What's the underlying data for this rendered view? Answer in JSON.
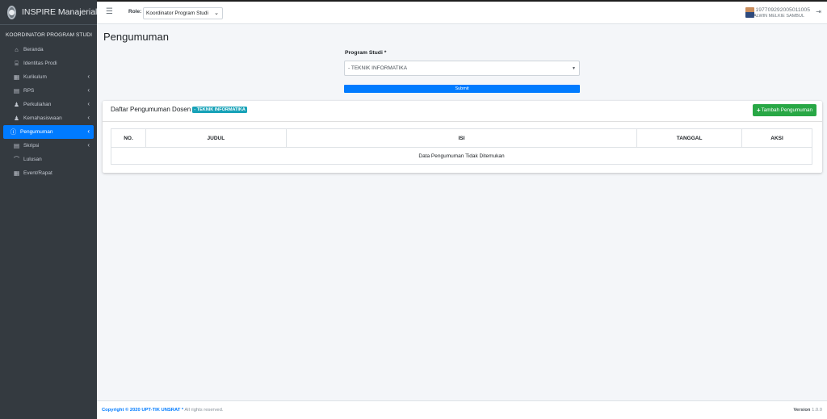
{
  "brand": {
    "title": "INSPIRE Manajerial"
  },
  "sidebar": {
    "heading": "KOORDINATOR PROGRAM STUDI",
    "items": [
      {
        "label": "Beranda",
        "icon": "home-icon",
        "glyph": "⌂",
        "expandable": false,
        "active": false
      },
      {
        "label": "Identitas Prodi",
        "icon": "university-icon",
        "glyph": "⌸",
        "expandable": false,
        "active": false
      },
      {
        "label": "Kurikulum",
        "icon": "table-icon",
        "glyph": "▦",
        "expandable": true,
        "active": false
      },
      {
        "label": "RPS",
        "icon": "book-icon",
        "glyph": "▤",
        "expandable": true,
        "active": false
      },
      {
        "label": "Perkuliahan",
        "icon": "users-icon",
        "glyph": "♟",
        "expandable": true,
        "active": false
      },
      {
        "label": "Kemahasiswaan",
        "icon": "students-icon",
        "glyph": "♟",
        "expandable": true,
        "active": false
      },
      {
        "label": "Pengumuman",
        "icon": "info-circle-icon",
        "glyph": "ⓘ",
        "expandable": true,
        "active": true
      },
      {
        "label": "Skripsi",
        "icon": "file-icon",
        "glyph": "▤",
        "expandable": true,
        "active": false
      },
      {
        "label": "Lulusan",
        "icon": "graduation-cap-icon",
        "glyph": "⌒",
        "expandable": false,
        "active": false
      },
      {
        "label": "Event/Rapat",
        "icon": "calendar-icon",
        "glyph": "▦",
        "expandable": false,
        "active": false
      }
    ]
  },
  "topbar": {
    "role_label": "Role:",
    "role_value": "Koordinator Program Studi",
    "user_id": "197709292005011005",
    "user_name": "ALWIN MELKIE SAMBUL"
  },
  "page": {
    "title": "Pengumuman"
  },
  "form": {
    "label": "Program Studi *",
    "selected": "- TEKNIK INFORMATIKA",
    "submit_label": "Submit"
  },
  "card": {
    "title": "Daftar Pengumuman Dosen",
    "badge": "- TEKNIK INFORMATIKA",
    "add_label": "Tambah Pengumuman",
    "columns": [
      "NO.",
      "JUDUL",
      "ISI",
      "TANGGAL",
      "AKSI"
    ],
    "empty_message": "Data Pengumuman Tidak Ditemukan"
  },
  "footer": {
    "copyright_prefix": "Copyright © 2020 UPT-TIK UNSRAT *",
    "copyright_suffix": "All rights reserved.",
    "version_label": "Version",
    "version_value": "1.0.0"
  },
  "colors": {
    "sidebar": "#343a40",
    "accent": "#007bff",
    "success": "#28a745",
    "badge": "#17a2b8"
  }
}
